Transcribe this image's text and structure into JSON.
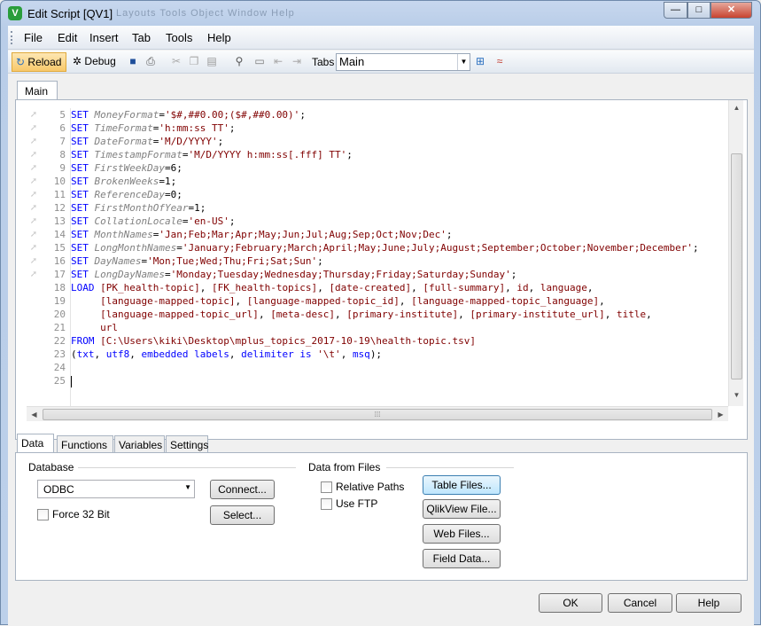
{
  "window": {
    "title": "Edit Script [QV1]",
    "ghost_title": "Layouts    Tools    Object    Window    Help",
    "app_icon_letter": "V",
    "controls": {
      "minimize": "—",
      "maximize": "□",
      "close": "✕"
    }
  },
  "menu": [
    "File",
    "Edit",
    "Insert",
    "Tab",
    "Tools",
    "Help"
  ],
  "toolbar": {
    "reload_label": "Reload",
    "debug_label": "Debug",
    "tabs_label": "Tabs",
    "tabs_value": "Main"
  },
  "script_tab": "Main",
  "script_lines": [
    {
      "n": "5",
      "parts": [
        [
          "kw",
          "SET "
        ],
        [
          "var",
          "MoneyFormat"
        ],
        [
          "txt",
          "="
        ],
        [
          "str",
          "'$#,##0.00;($#,##0.00)'"
        ],
        [
          "txt",
          ";"
        ]
      ]
    },
    {
      "n": "6",
      "parts": [
        [
          "kw",
          "SET "
        ],
        [
          "var",
          "TimeFormat"
        ],
        [
          "txt",
          "="
        ],
        [
          "str",
          "'h:mm:ss TT'"
        ],
        [
          "txt",
          ";"
        ]
      ]
    },
    {
      "n": "7",
      "parts": [
        [
          "kw",
          "SET "
        ],
        [
          "var",
          "DateFormat"
        ],
        [
          "txt",
          "="
        ],
        [
          "str",
          "'M/D/YYYY'"
        ],
        [
          "txt",
          ";"
        ]
      ]
    },
    {
      "n": "8",
      "parts": [
        [
          "kw",
          "SET "
        ],
        [
          "var",
          "TimestampFormat"
        ],
        [
          "txt",
          "="
        ],
        [
          "str",
          "'M/D/YYYY h:mm:ss[.fff] TT'"
        ],
        [
          "txt",
          ";"
        ]
      ]
    },
    {
      "n": "9",
      "parts": [
        [
          "kw",
          "SET "
        ],
        [
          "var",
          "FirstWeekDay"
        ],
        [
          "txt",
          "=6;"
        ]
      ]
    },
    {
      "n": "10",
      "parts": [
        [
          "kw",
          "SET "
        ],
        [
          "var",
          "BrokenWeeks"
        ],
        [
          "txt",
          "=1;"
        ]
      ]
    },
    {
      "n": "11",
      "parts": [
        [
          "kw",
          "SET "
        ],
        [
          "var",
          "ReferenceDay"
        ],
        [
          "txt",
          "=0;"
        ]
      ]
    },
    {
      "n": "12",
      "parts": [
        [
          "kw",
          "SET "
        ],
        [
          "var",
          "FirstMonthOfYear"
        ],
        [
          "txt",
          "=1;"
        ]
      ]
    },
    {
      "n": "13",
      "parts": [
        [
          "kw",
          "SET "
        ],
        [
          "var",
          "CollationLocale"
        ],
        [
          "txt",
          "="
        ],
        [
          "str",
          "'en-US'"
        ],
        [
          "txt",
          ";"
        ]
      ]
    },
    {
      "n": "14",
      "parts": [
        [
          "kw",
          "SET "
        ],
        [
          "var",
          "MonthNames"
        ],
        [
          "txt",
          "="
        ],
        [
          "str",
          "'Jan;Feb;Mar;Apr;May;Jun;Jul;Aug;Sep;Oct;Nov;Dec'"
        ],
        [
          "txt",
          ";"
        ]
      ]
    },
    {
      "n": "15",
      "parts": [
        [
          "kw",
          "SET "
        ],
        [
          "var",
          "LongMonthNames"
        ],
        [
          "txt",
          "="
        ],
        [
          "str",
          "'January;February;March;April;May;June;July;August;September;October;November;December'"
        ],
        [
          "txt",
          ";"
        ]
      ]
    },
    {
      "n": "16",
      "parts": [
        [
          "kw",
          "SET "
        ],
        [
          "var",
          "DayNames"
        ],
        [
          "txt",
          "="
        ],
        [
          "str",
          "'Mon;Tue;Wed;Thu;Fri;Sat;Sun'"
        ],
        [
          "txt",
          ";"
        ]
      ]
    },
    {
      "n": "17",
      "parts": [
        [
          "kw",
          "SET "
        ],
        [
          "var",
          "LongDayNames"
        ],
        [
          "txt",
          "="
        ],
        [
          "str",
          "'Monday;Tuesday;Wednesday;Thursday;Friday;Saturday;Sunday'"
        ],
        [
          "txt",
          ";"
        ]
      ]
    },
    {
      "n": "18",
      "parts": [
        [
          "kw",
          "LOAD "
        ],
        [
          "fld",
          "[PK_health-topic]"
        ],
        [
          "txt",
          ", "
        ],
        [
          "fld",
          "[FK_health-topics]"
        ],
        [
          "txt",
          ", "
        ],
        [
          "fld",
          "[date-created]"
        ],
        [
          "txt",
          ", "
        ],
        [
          "fld",
          "[full-summary]"
        ],
        [
          "txt",
          ", "
        ],
        [
          "fld",
          "id"
        ],
        [
          "txt",
          ", "
        ],
        [
          "fld",
          "language"
        ],
        [
          "txt",
          ","
        ]
      ]
    },
    {
      "n": "19",
      "parts": [
        [
          "txt",
          "     "
        ],
        [
          "fld",
          "[language-mapped-topic]"
        ],
        [
          "txt",
          ", "
        ],
        [
          "fld",
          "[language-mapped-topic_id]"
        ],
        [
          "txt",
          ", "
        ],
        [
          "fld",
          "[language-mapped-topic_language]"
        ],
        [
          "txt",
          ","
        ]
      ]
    },
    {
      "n": "20",
      "parts": [
        [
          "txt",
          "     "
        ],
        [
          "fld",
          "[language-mapped-topic_url]"
        ],
        [
          "txt",
          ", "
        ],
        [
          "fld",
          "[meta-desc]"
        ],
        [
          "txt",
          ", "
        ],
        [
          "fld",
          "[primary-institute]"
        ],
        [
          "txt",
          ", "
        ],
        [
          "fld",
          "[primary-institute_url]"
        ],
        [
          "txt",
          ", "
        ],
        [
          "fld",
          "title"
        ],
        [
          "txt",
          ","
        ]
      ]
    },
    {
      "n": "21",
      "parts": [
        [
          "txt",
          "     "
        ],
        [
          "fld",
          "url"
        ]
      ]
    },
    {
      "n": "22",
      "parts": [
        [
          "kw",
          "FROM "
        ],
        [
          "fld",
          "[C:\\Users\\kiki\\Desktop\\mplus_topics_2017-10-19\\health-topic.tsv]"
        ]
      ]
    },
    {
      "n": "23",
      "parts": [
        [
          "txt",
          "("
        ],
        [
          "kw",
          "txt"
        ],
        [
          "txt",
          ", "
        ],
        [
          "kw",
          "utf8"
        ],
        [
          "txt",
          ", "
        ],
        [
          "kw",
          "embedded labels"
        ],
        [
          "txt",
          ", "
        ],
        [
          "kw",
          "delimiter is "
        ],
        [
          "str",
          "'\\t'"
        ],
        [
          "txt",
          ", "
        ],
        [
          "kw",
          "msq"
        ],
        [
          "txt",
          ");"
        ]
      ]
    },
    {
      "n": "24",
      "parts": []
    },
    {
      "n": "25",
      "parts": [
        [
          "cursor",
          ""
        ]
      ]
    }
  ],
  "lower_tabs": [
    "Data",
    "Functions",
    "Variables",
    "Settings"
  ],
  "data_panel": {
    "database_label": "Database",
    "database_value": "ODBC",
    "connect_label": "Connect...",
    "select_label": "Select...",
    "force32_label": "Force 32 Bit",
    "files_label": "Data from Files",
    "relative_paths_label": "Relative Paths",
    "use_ftp_label": "Use FTP",
    "table_files_label": "Table Files...",
    "qlikview_file_label": "QlikView File...",
    "web_files_label": "Web Files...",
    "field_data_label": "Field Data..."
  },
  "footer": {
    "ok_label": "OK",
    "cancel_label": "Cancel",
    "help_label": "Help"
  }
}
